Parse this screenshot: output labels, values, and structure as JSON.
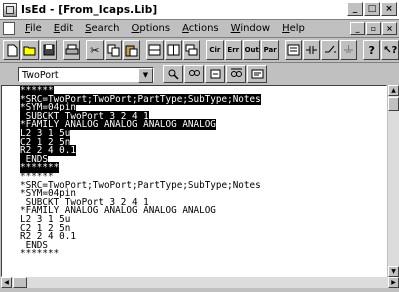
{
  "window": {
    "title": "IsEd - [From_Icaps.Lib]"
  },
  "caption_buttons": {
    "minimize": "_",
    "restore": "□",
    "close": "×"
  },
  "mdi_buttons": {
    "minimize": "_",
    "restore": "▫",
    "close": "×"
  },
  "menu": [
    {
      "pre": "",
      "u": "F",
      "post": "ile"
    },
    {
      "pre": "",
      "u": "E",
      "post": "dit"
    },
    {
      "pre": "",
      "u": "S",
      "post": "earch"
    },
    {
      "pre": "",
      "u": "O",
      "post": "ptions"
    },
    {
      "pre": "",
      "u": "A",
      "post": "ctions"
    },
    {
      "pre": "",
      "u": "W",
      "post": "indow"
    },
    {
      "pre": "",
      "u": "H",
      "post": "elp"
    }
  ],
  "toolbar_text_buttons": {
    "cir": "Cir",
    "err": "Err",
    "out": "Out",
    "par": "Par"
  },
  "combo": {
    "value": "TwoPort"
  },
  "editor_lines": [
    {
      "text": "******",
      "sel": true
    },
    {
      "text": "*SRC=TwoPort;TwoPort;PartType;SubType;Notes",
      "sel": true
    },
    {
      "text": "*SYM=04pin",
      "sel": true
    },
    {
      "text": " SUBCKT TwoPort 3 2 4 1",
      "sel": true
    },
    {
      "text": "*FAMILY ANALOG ANALOG ANALOG ANALOG",
      "sel": true
    },
    {
      "text": "L2 3 1 5u",
      "sel": true
    },
    {
      "text": "C2 1 2 5n",
      "sel": true
    },
    {
      "text": "R2 2 4 0.1",
      "sel": true
    },
    {
      "text": " ENDS",
      "sel": true
    },
    {
      "text": "*******",
      "sel": true
    },
    {
      "text": "******",
      "sel": false
    },
    {
      "text": "*SRC=TwoPort;TwoPort;PartType;SubType;Notes",
      "sel": false
    },
    {
      "text": "*SYM=04pin",
      "sel": false
    },
    {
      "text": " SUBCKT TwoPort 3 2 4 1",
      "sel": false
    },
    {
      "text": "*FAMILY ANALOG ANALOG ANALOG ANALOG",
      "sel": false
    },
    {
      "text": "L2 3 1 5u",
      "sel": false
    },
    {
      "text": "C2 1 2 5n",
      "sel": false
    },
    {
      "text": "R2 2 4 0.1",
      "sel": false
    },
    {
      "text": " ENDS",
      "sel": false
    },
    {
      "text": "*******",
      "sel": false
    }
  ]
}
